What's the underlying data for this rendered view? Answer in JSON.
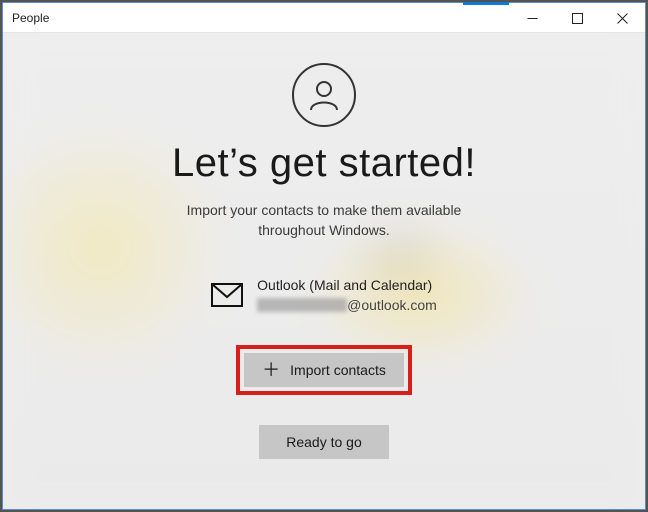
{
  "window": {
    "title": "People"
  },
  "main": {
    "headline": "Let’s get started!",
    "subline1": "Import your contacts to make them available",
    "subline2": "throughout Windows."
  },
  "account": {
    "provider": "Outlook (Mail and Calendar)",
    "email_domain": "@outlook.com"
  },
  "buttons": {
    "import": "Import contacts",
    "ready": "Ready to go"
  }
}
